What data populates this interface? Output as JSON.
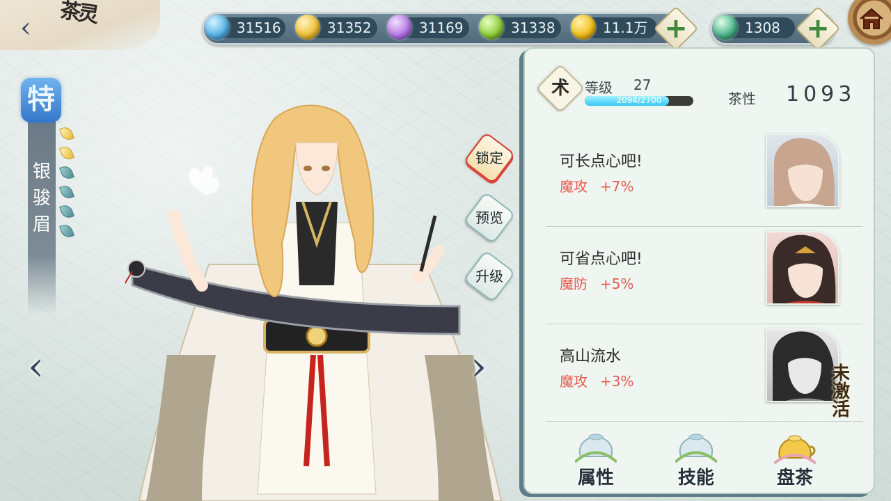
{
  "header": {
    "back_icon": "chevron-left-icon",
    "logo_text": "茶灵"
  },
  "currencies": [
    {
      "name": "blue-gem",
      "value": "31516",
      "color": "#5ab6e8"
    },
    {
      "name": "gold-gem",
      "value": "31352",
      "color": "#f0c13a"
    },
    {
      "name": "purple-gem",
      "value": "31169",
      "color": "#b67be6"
    },
    {
      "name": "green-gem",
      "value": "31338",
      "color": "#8fce3c"
    },
    {
      "name": "gold-coin",
      "value": "11.1万",
      "color": "#f2c11e"
    }
  ],
  "jade": {
    "value": "1308",
    "color": "#4fb78e"
  },
  "side": {
    "rank_char": "特",
    "name": "银骏眉",
    "leaves_gold": 2,
    "leaves_total": 6
  },
  "actions": {
    "lock": "锁定",
    "preview": "预览",
    "upgrade": "升级"
  },
  "panel": {
    "rank_badge": "术",
    "level_label": "等级",
    "level_value": "27",
    "exp_text": "2094/2700",
    "exp_ratio": 0.7755,
    "tea_label": "茶性",
    "tea_value": "1093",
    "bonds": [
      {
        "name": "可长点心吧!",
        "stat": "魔攻",
        "value": "+7%",
        "active": true
      },
      {
        "name": "可省点心吧!",
        "stat": "魔防",
        "value": "+5%",
        "active": true
      },
      {
        "name": "高山流水",
        "stat": "魔攻",
        "value": "+3%",
        "active": false,
        "inactive_label": "未激活"
      }
    ],
    "tabs": [
      {
        "label": "属性"
      },
      {
        "label": "技能"
      },
      {
        "label": "盘茶"
      }
    ]
  },
  "colors": {
    "accent_red": "#e65a4f",
    "bar_blue": "#39c6f2"
  }
}
